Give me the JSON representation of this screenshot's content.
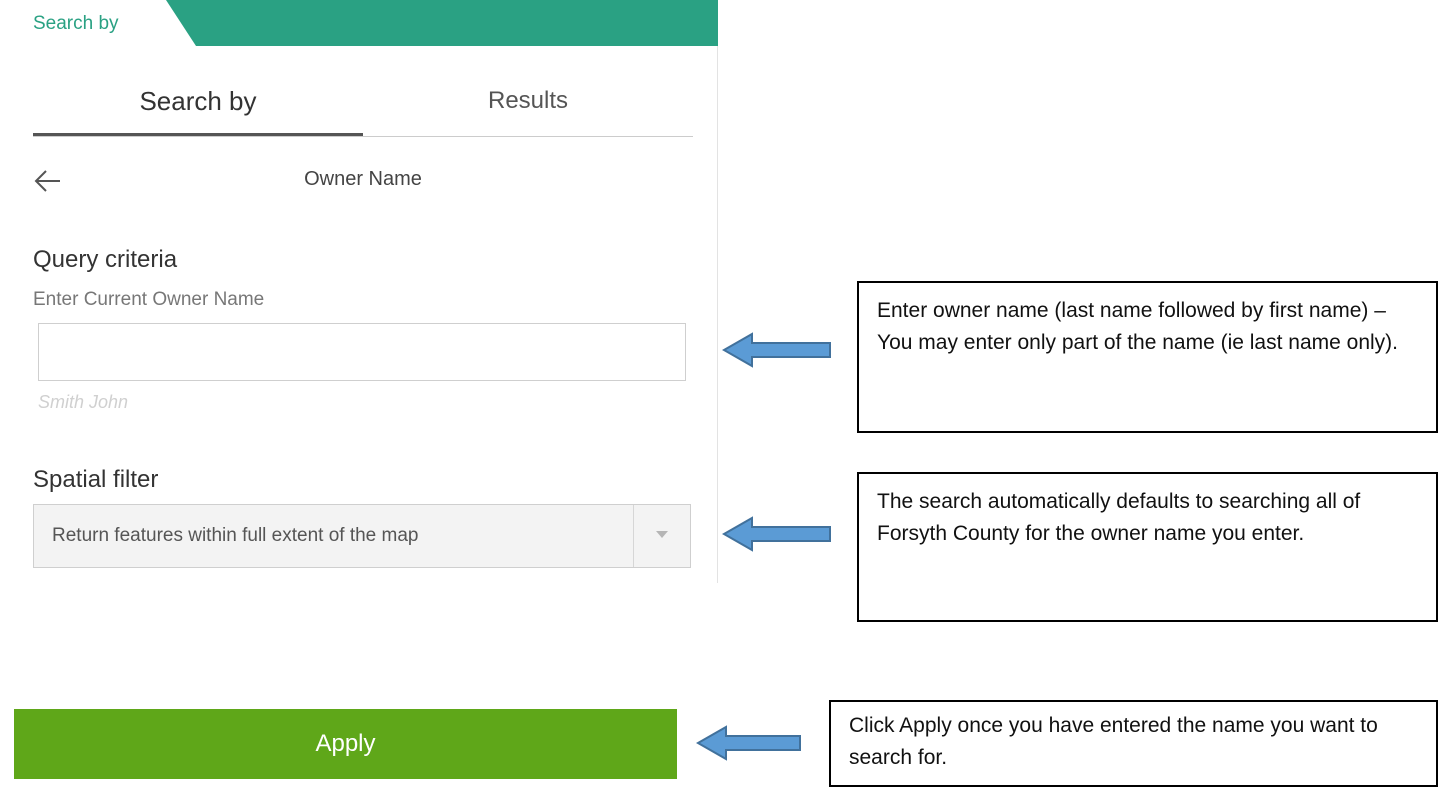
{
  "panel": {
    "title": "Search by",
    "tabs": [
      {
        "label": "Search by",
        "active": true
      },
      {
        "label": "Results",
        "active": false
      }
    ],
    "subheader_title": "Owner Name",
    "query_criteria": {
      "heading": "Query criteria",
      "field_label": "Enter Current Owner Name",
      "input_value": "",
      "hint": "Smith John"
    },
    "spatial_filter": {
      "heading": "Spatial filter",
      "selected": "Return features within full extent of the map"
    }
  },
  "apply_button": {
    "label": "Apply"
  },
  "callouts": [
    "Enter owner name (last name followed by first name) – You may enter only part of the name (ie last name only).",
    "The search automatically defaults to searching all of Forsyth County for the owner name you enter.",
    "Click Apply once you have entered the name you want to search for."
  ],
  "colors": {
    "accent_teal": "#2aa183",
    "apply_green": "#5fa719",
    "arrow_blue": "#5b9bd5"
  },
  "icons": {
    "back": "arrow-left-icon",
    "select": "chevron-down-icon",
    "callout_arrow": "arrow-left-icon"
  }
}
